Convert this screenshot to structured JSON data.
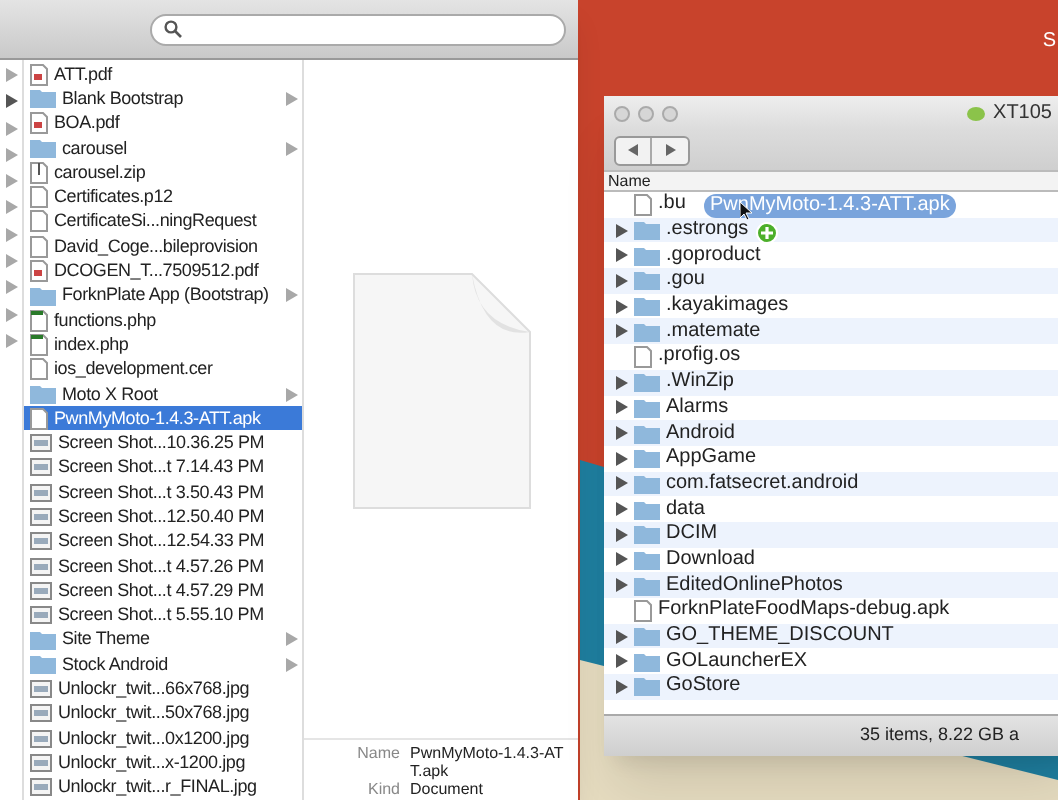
{
  "desktop": {
    "label": "S"
  },
  "finder": {
    "files": [
      {
        "name": "ATT.pdf",
        "kind": "pdf",
        "selected": false
      },
      {
        "name": "Blank Bootstrap",
        "kind": "folder",
        "selected": false
      },
      {
        "name": "BOA.pdf",
        "kind": "pdf",
        "selected": false
      },
      {
        "name": "carousel",
        "kind": "folder",
        "selected": false
      },
      {
        "name": "carousel.zip",
        "kind": "zip",
        "selected": false
      },
      {
        "name": "Certificates.p12",
        "kind": "doc",
        "selected": false
      },
      {
        "name": "CertificateSi...ningRequest",
        "kind": "doc",
        "selected": false
      },
      {
        "name": "David_Coge...bileprovision",
        "kind": "doc",
        "selected": false
      },
      {
        "name": "DCOGEN_T...7509512.pdf",
        "kind": "pdf",
        "selected": false
      },
      {
        "name": "ForknPlate App (Bootstrap)",
        "kind": "folder",
        "selected": false
      },
      {
        "name": "functions.php",
        "kind": "php",
        "selected": false
      },
      {
        "name": "index.php",
        "kind": "php",
        "selected": false
      },
      {
        "name": "ios_development.cer",
        "kind": "doc",
        "selected": false
      },
      {
        "name": "Moto X Root",
        "kind": "folder",
        "selected": false
      },
      {
        "name": "PwnMyMoto-1.4.3-ATT.apk",
        "kind": "doc",
        "selected": true
      },
      {
        "name": "Screen Shot...10.36.25 PM",
        "kind": "image",
        "selected": false
      },
      {
        "name": "Screen Shot...t 7.14.43 PM",
        "kind": "image",
        "selected": false
      },
      {
        "name": "Screen Shot...t 3.50.43 PM",
        "kind": "image",
        "selected": false
      },
      {
        "name": "Screen Shot...12.50.40 PM",
        "kind": "image",
        "selected": false
      },
      {
        "name": "Screen Shot...12.54.33 PM",
        "kind": "image",
        "selected": false
      },
      {
        "name": "Screen Shot...t 4.57.26 PM",
        "kind": "image",
        "selected": false
      },
      {
        "name": "Screen Shot...t 4.57.29 PM",
        "kind": "image",
        "selected": false
      },
      {
        "name": "Screen Shot...t 5.55.10 PM",
        "kind": "image",
        "selected": false
      },
      {
        "name": "Site Theme",
        "kind": "folder",
        "selected": false
      },
      {
        "name": "Stock Android",
        "kind": "folder",
        "selected": false
      },
      {
        "name": "Unlockr_twit...66x768.jpg",
        "kind": "image",
        "selected": false
      },
      {
        "name": "Unlockr_twit...50x768.jpg",
        "kind": "image",
        "selected": false
      },
      {
        "name": "Unlockr_twit...0x1200.jpg",
        "kind": "image",
        "selected": false
      },
      {
        "name": "Unlockr_twit...x-1200.jpg",
        "kind": "image",
        "selected": false
      },
      {
        "name": "Unlockr_twit...r_FINAL.jpg",
        "kind": "image",
        "selected": false
      }
    ],
    "preview": {
      "info": [
        {
          "label": "Name",
          "value": "PwnMyMoto-1.4.3-ATT.apk"
        },
        {
          "label": "Kind",
          "value": "Document"
        }
      ]
    }
  },
  "device_window": {
    "title": "XT105",
    "column": "Name",
    "rows": [
      {
        "name": ".bu",
        "kind": "file"
      },
      {
        "name": ".estrongs",
        "kind": "folder"
      },
      {
        "name": ".goproduct",
        "kind": "folder"
      },
      {
        "name": ".gou",
        "kind": "folder"
      },
      {
        "name": ".kayakimages",
        "kind": "folder"
      },
      {
        "name": ".matemate",
        "kind": "folder"
      },
      {
        "name": ".profig.os",
        "kind": "file"
      },
      {
        "name": ".WinZip",
        "kind": "folder"
      },
      {
        "name": "Alarms",
        "kind": "folder"
      },
      {
        "name": "Android",
        "kind": "folder"
      },
      {
        "name": "AppGame",
        "kind": "folder"
      },
      {
        "name": "com.fatsecret.android",
        "kind": "folder"
      },
      {
        "name": "data",
        "kind": "folder"
      },
      {
        "name": "DCIM",
        "kind": "folder"
      },
      {
        "name": "Download",
        "kind": "folder"
      },
      {
        "name": "EditedOnlinePhotos",
        "kind": "folder"
      },
      {
        "name": "ForknPlateFoodMaps-debug.apk",
        "kind": "file"
      },
      {
        "name": "GO_THEME_DISCOUNT",
        "kind": "folder"
      },
      {
        "name": "GOLauncherEX",
        "kind": "folder"
      },
      {
        "name": "GoStore",
        "kind": "folder"
      }
    ],
    "drag_item": "PwnMyMoto-1.4.3-ATT.apk",
    "status": "35 items, 8.22 GB a"
  }
}
